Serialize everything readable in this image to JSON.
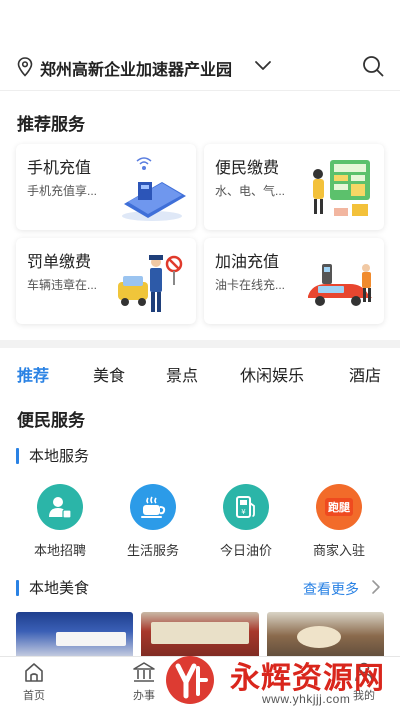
{
  "header": {
    "location": "郑州高新企业加速器产业园",
    "icons": {
      "pin": "location-pin-icon",
      "chevron": "chevron-down-icon",
      "search": "search-icon"
    }
  },
  "recommended": {
    "title": "推荐服务",
    "cards": [
      {
        "title": "手机充值",
        "subtitle": "手机充值享...",
        "art": "phone-recharge-illustration"
      },
      {
        "title": "便民缴费",
        "subtitle": "水、电、气...",
        "art": "utility-payment-illustration"
      },
      {
        "title": "罚单缴费",
        "subtitle": "车辆违章在...",
        "art": "traffic-fine-illustration"
      },
      {
        "title": "加油充值",
        "subtitle": "油卡在线充...",
        "art": "fuel-recharge-illustration"
      }
    ]
  },
  "tabs": [
    "推荐",
    "美食",
    "景点",
    "休闲娱乐",
    "酒店"
  ],
  "active_tab": "推荐",
  "convenience": {
    "title": "便民服务",
    "local_services_title": "本地服务",
    "services": [
      {
        "label": "本地招聘",
        "icon": "recruit-icon",
        "color": "#2bb5a8"
      },
      {
        "label": "生活服务",
        "icon": "coffee-cup-icon",
        "color": "#2c9be8"
      },
      {
        "label": "今日油价",
        "icon": "fuel-pump-icon",
        "color": "#2bb5a8"
      },
      {
        "label": "商家入驻",
        "icon": "merchant-icon",
        "color": "#f26b2a",
        "badge": "跑腿"
      }
    ]
  },
  "local_food": {
    "title": "本地美食",
    "more": "查看更多"
  },
  "bottom_nav": [
    {
      "label": "首页",
      "icon": "home-icon"
    },
    {
      "label": "办事",
      "icon": "government-icon"
    },
    {
      "label": "",
      "icon": "center-icon"
    },
    {
      "label": "",
      "icon": ""
    },
    {
      "label": "我的",
      "icon": "profile-icon"
    }
  ],
  "watermark": {
    "text": "永辉资源网",
    "url": "www.yhkjjj.com"
  },
  "colors": {
    "accent": "#2a82e4",
    "teal": "#2bb5a8",
    "orange": "#f26b2a",
    "watermark": "#d9261c"
  }
}
